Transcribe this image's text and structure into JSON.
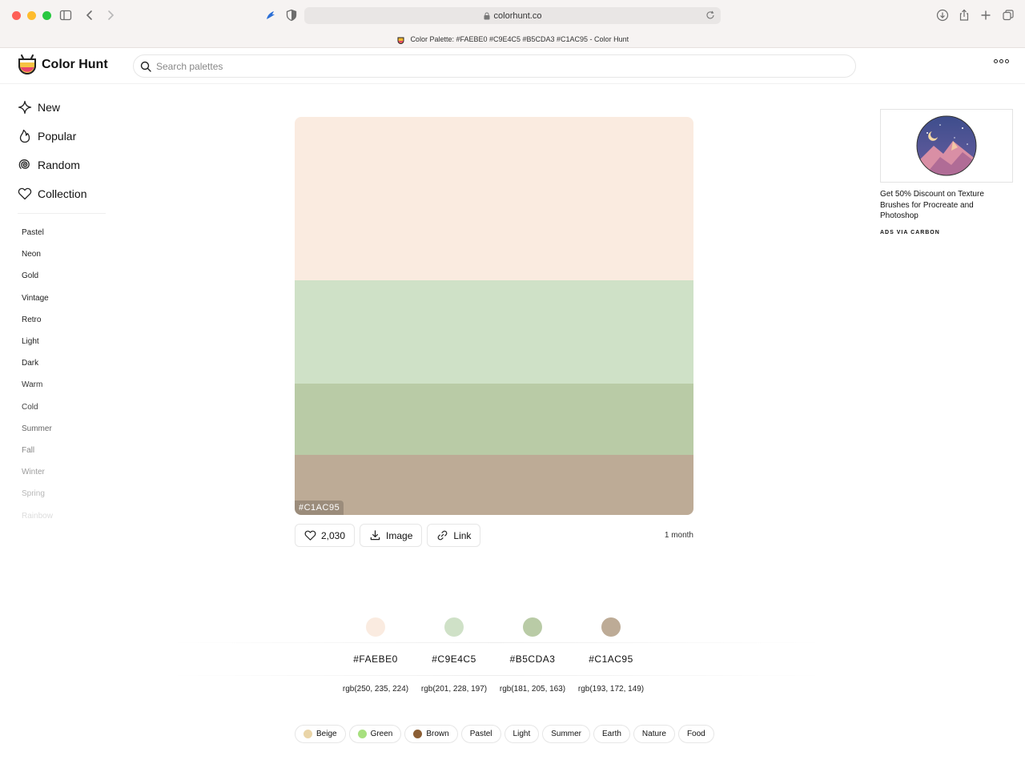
{
  "browser": {
    "url": "colorhunt.co",
    "tab_title": "Color Palette: #FAEBE0 #C9E4C5 #B5CDA3 #C1AC95 - Color Hunt"
  },
  "header": {
    "logo_text": "Color Hunt",
    "search_placeholder": "Search palettes"
  },
  "sidebar": {
    "nav": [
      {
        "label": "New",
        "icon": "sparkle-icon"
      },
      {
        "label": "Popular",
        "icon": "flame-icon"
      },
      {
        "label": "Random",
        "icon": "spiral-icon"
      },
      {
        "label": "Collection",
        "icon": "heart-icon"
      }
    ],
    "tags": [
      {
        "label": "Pastel",
        "color": "#222222"
      },
      {
        "label": "Neon",
        "color": "#222222"
      },
      {
        "label": "Gold",
        "color": "#222222"
      },
      {
        "label": "Vintage",
        "color": "#222222"
      },
      {
        "label": "Retro",
        "color": "#222222"
      },
      {
        "label": "Light",
        "color": "#222222"
      },
      {
        "label": "Dark",
        "color": "#222222"
      },
      {
        "label": "Warm",
        "color": "#333333"
      },
      {
        "label": "Cold",
        "color": "#444444"
      },
      {
        "label": "Summer",
        "color": "#666666"
      },
      {
        "label": "Fall",
        "color": "#888888"
      },
      {
        "label": "Winter",
        "color": "#9c9c9c"
      },
      {
        "label": "Spring",
        "color": "#b8b8b8"
      },
      {
        "label": "Rainbow",
        "color": "#dddddd"
      }
    ]
  },
  "palette": {
    "colors": [
      {
        "hex": "#FAEBE0",
        "rgb": "rgb(250, 235, 224)",
        "value": "#faebe0",
        "share": 0.41
      },
      {
        "hex": "#C9E4C5",
        "rgb": "rgb(201, 228, 197)",
        "value": "#cfe1c7",
        "share": 0.26
      },
      {
        "hex": "#B5CDA3",
        "rgb": "rgb(181, 205, 163)",
        "value": "#b9cba6",
        "share": 0.18
      },
      {
        "hex": "#C1AC95",
        "rgb": "rgb(193, 172, 149)",
        "value": "#bdab96",
        "share": 0.15
      }
    ],
    "overlay_label": "#C1AC95"
  },
  "actions": {
    "likes": "2,030",
    "image_label": "Image",
    "link_label": "Link",
    "time": "1 month"
  },
  "tags": [
    {
      "label": "Beige",
      "dot": "#ead5a8"
    },
    {
      "label": "Green",
      "dot": "#a7e07e"
    },
    {
      "label": "Brown",
      "dot": "#8b5e34"
    },
    {
      "label": "Pastel"
    },
    {
      "label": "Light"
    },
    {
      "label": "Summer"
    },
    {
      "label": "Earth"
    },
    {
      "label": "Nature"
    },
    {
      "label": "Food"
    }
  ],
  "ad": {
    "text": "Get 50% Discount on Texture Brushes for Procreate and Photoshop",
    "via": "ADS VIA CARBON"
  }
}
